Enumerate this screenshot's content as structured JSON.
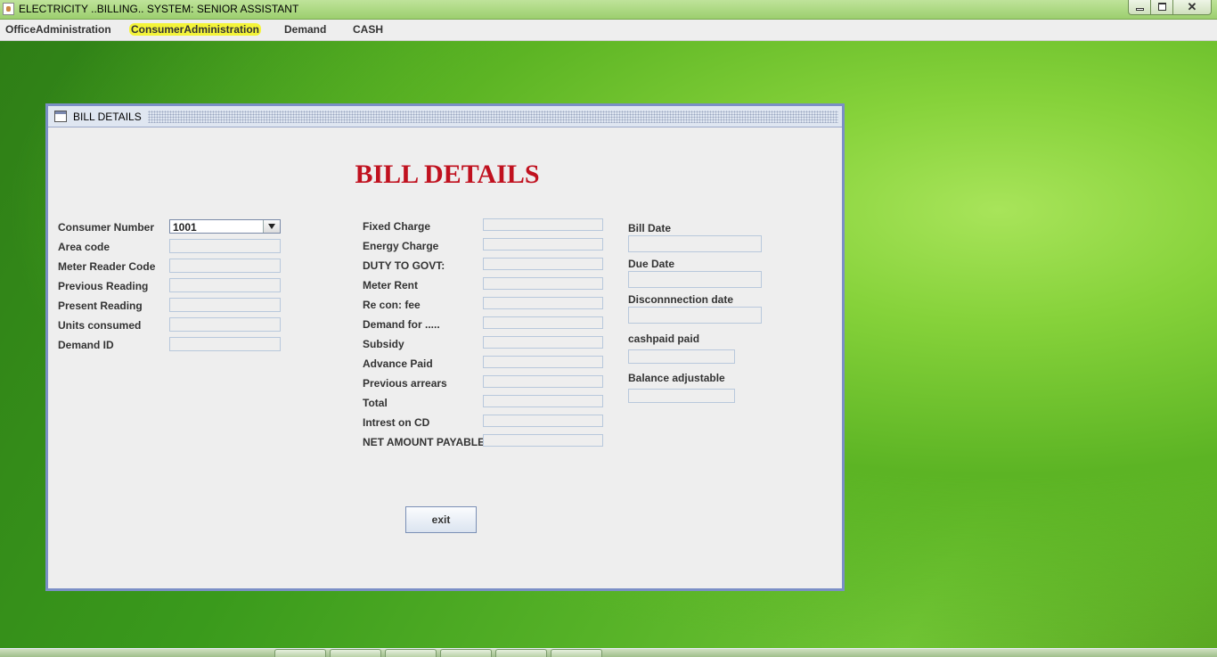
{
  "window": {
    "title": "ELECTRICITY ..BILLING.. SYSTEM: SENIOR ASSISTANT",
    "min_icon": "minimize-icon",
    "max_icon": "restore-icon",
    "close_icon": "close-icon",
    "close_glyph": "✕"
  },
  "menu": {
    "items": [
      "OfficeAdministration",
      "ConsumerAdministration",
      "Demand",
      "CASH"
    ],
    "selected": "ConsumerAdministration",
    "highlight_color": "#f4f43a"
  },
  "frame": {
    "title": "BILL DETAILS",
    "heading": "BILL DETAILS",
    "heading_color": "#c0111f",
    "left_fields": {
      "consumer_number": {
        "label": "Consumer Number",
        "value": "1001"
      },
      "area_code": {
        "label": "Area code",
        "value": ""
      },
      "meter_reader_code": {
        "label": "Meter Reader Code",
        "value": ""
      },
      "previous_reading": {
        "label": "Previous Reading",
        "value": ""
      },
      "present_reading": {
        "label": "Present Reading",
        "value": ""
      },
      "units_consumed": {
        "label": "Units consumed",
        "value": ""
      },
      "demand_id": {
        "label": "Demand ID",
        "value": ""
      }
    },
    "middle_fields": {
      "fixed_charge": {
        "label": "Fixed Charge",
        "value": ""
      },
      "energy_charge": {
        "label": "Energy Charge",
        "value": ""
      },
      "duty_to_govt": {
        "label": "DUTY TO GOVT:",
        "value": ""
      },
      "meter_rent": {
        "label": "Meter Rent",
        "value": ""
      },
      "recon_fee": {
        "label": "Re con: fee",
        "value": ""
      },
      "demand_for": {
        "label": "Demand for  .....",
        "value": ""
      },
      "subsidy": {
        "label": "Subsidy",
        "value": ""
      },
      "advance_paid": {
        "label": "Advance Paid",
        "value": ""
      },
      "previous_arrears": {
        "label": "Previous arrears",
        "value": ""
      },
      "total": {
        "label": "Total",
        "value": ""
      },
      "interest_on_cd": {
        "label": "Intrest on CD",
        "value": ""
      },
      "net_amount_payable": {
        "label": "NET AMOUNT PAYABLE",
        "value": ""
      }
    },
    "right_fields": {
      "bill_date": {
        "label": "Bill Date",
        "value": ""
      },
      "due_date": {
        "label": "Due Date",
        "value": ""
      },
      "disconnection_date": {
        "label": "Disconnnection date",
        "value": ""
      },
      "cashpaid": {
        "label": "cashpaid paid",
        "value": ""
      },
      "balance_adjustable": {
        "label": "Balance adjustable",
        "value": ""
      }
    },
    "exit_label": "exit"
  }
}
